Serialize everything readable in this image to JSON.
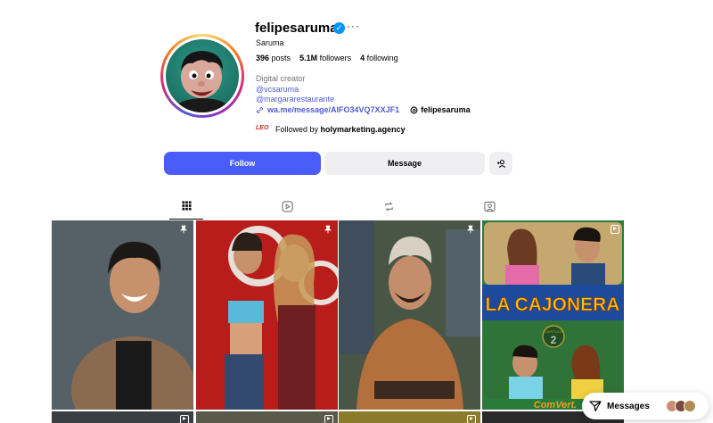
{
  "profile": {
    "username": "felipesaruma",
    "full_name": "Saruma",
    "posts_count": "396",
    "posts_label": "posts",
    "followers_count": "5.1M",
    "followers_label": "followers",
    "following_count": "4",
    "following_label": "following",
    "category": "Digital creator",
    "mention1": "@vcsaruma",
    "mention2": "@margararestaurante",
    "link": "wa.me/message/AIFO34VQ7XXJF1",
    "threads_handle": "felipesaruma",
    "followed_by_prefix": "Followed by",
    "followed_by_name": "holymarketing.agency",
    "followed_logo_text": "LEO"
  },
  "actions": {
    "follow_label": "Follow",
    "message_label": "Message"
  },
  "tabs": [
    {
      "name": "posts-grid-icon",
      "active": true
    },
    {
      "name": "reels-icon",
      "active": false
    },
    {
      "name": "reposts-icon",
      "active": false
    },
    {
      "name": "tagged-icon",
      "active": false
    }
  ],
  "grid": {
    "tile4_title": "LA CAJONERA",
    "tile4_episode_label": "CAPÍTULO",
    "tile4_episode_number": "2",
    "tile4_brand": "ComVert."
  },
  "messages_pill": {
    "label": "Messages"
  },
  "colors": {
    "accent": "#4a5df9",
    "link": "#4f5bd5",
    "verified": "#0095f6"
  }
}
